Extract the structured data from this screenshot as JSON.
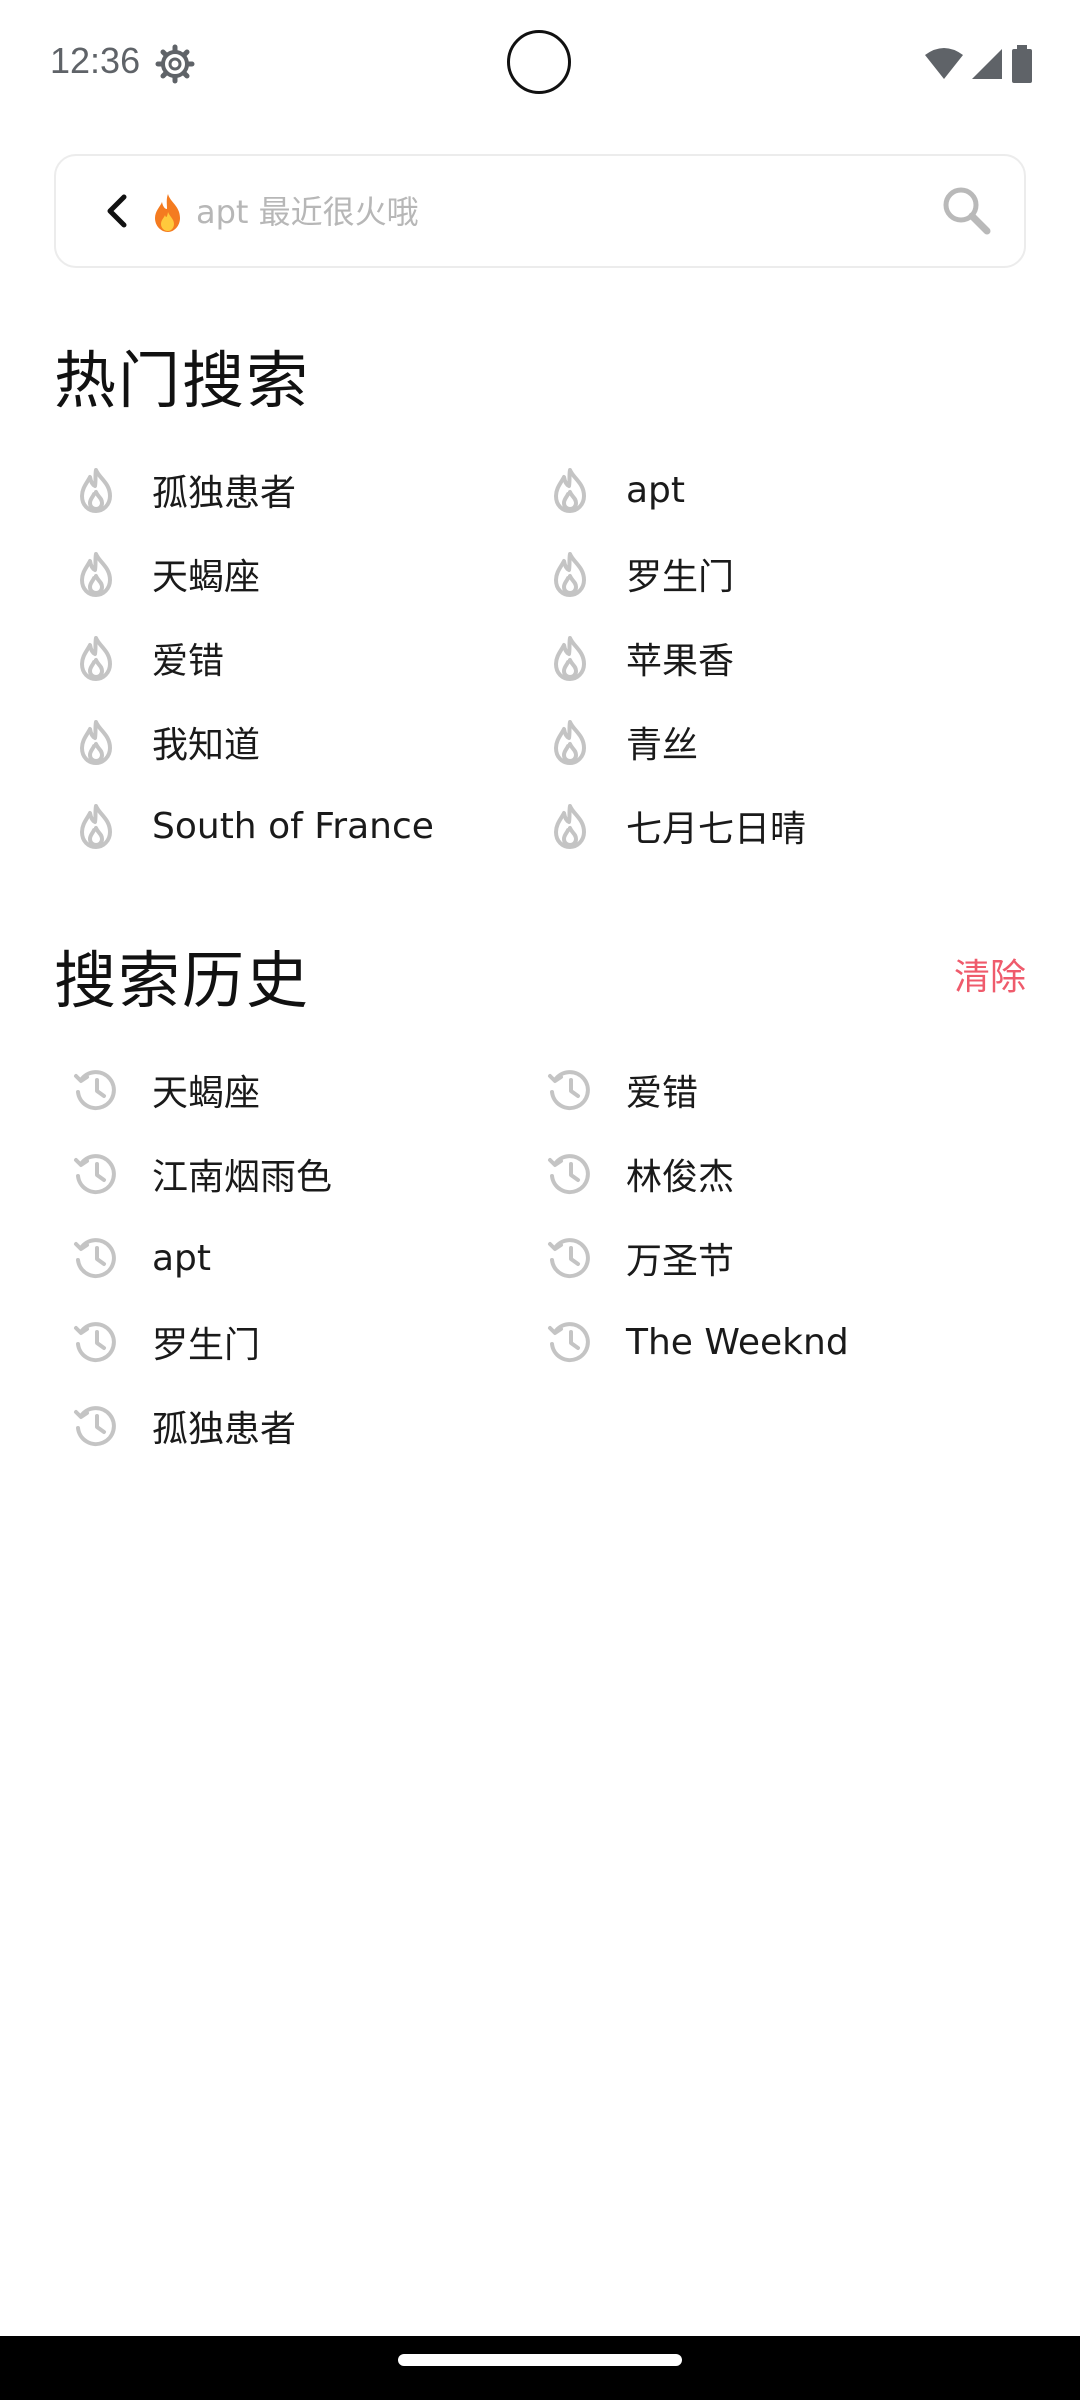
{
  "status_bar": {
    "time": "12:36"
  },
  "search": {
    "placeholder": "apt 最近很火哦"
  },
  "hot_search": {
    "title": "热门搜索",
    "items": [
      {
        "label": "孤独患者"
      },
      {
        "label": "apt"
      },
      {
        "label": "天蝎座"
      },
      {
        "label": "罗生门"
      },
      {
        "label": "爱错"
      },
      {
        "label": "苹果香"
      },
      {
        "label": "我知道"
      },
      {
        "label": "青丝"
      },
      {
        "label": "South of France"
      },
      {
        "label": "七月七日晴"
      }
    ]
  },
  "history": {
    "title": "搜索历史",
    "clear_label": "清除",
    "items": [
      {
        "label": "天蝎座"
      },
      {
        "label": "爱错"
      },
      {
        "label": "江南烟雨色"
      },
      {
        "label": "林俊杰"
      },
      {
        "label": "apt"
      },
      {
        "label": "万圣节"
      },
      {
        "label": "罗生门"
      },
      {
        "label": "The Weeknd"
      },
      {
        "label": "孤独患者"
      }
    ]
  },
  "colors": {
    "accent": "#ef5b6c",
    "icon_gray": "#c4c4c4",
    "text": "#1a1a1a"
  },
  "icons": {
    "hot_item": "flame-icon",
    "history_item": "history-clock-icon",
    "search": "search-icon",
    "back": "chevron-left-icon",
    "settings": "gear-icon"
  }
}
